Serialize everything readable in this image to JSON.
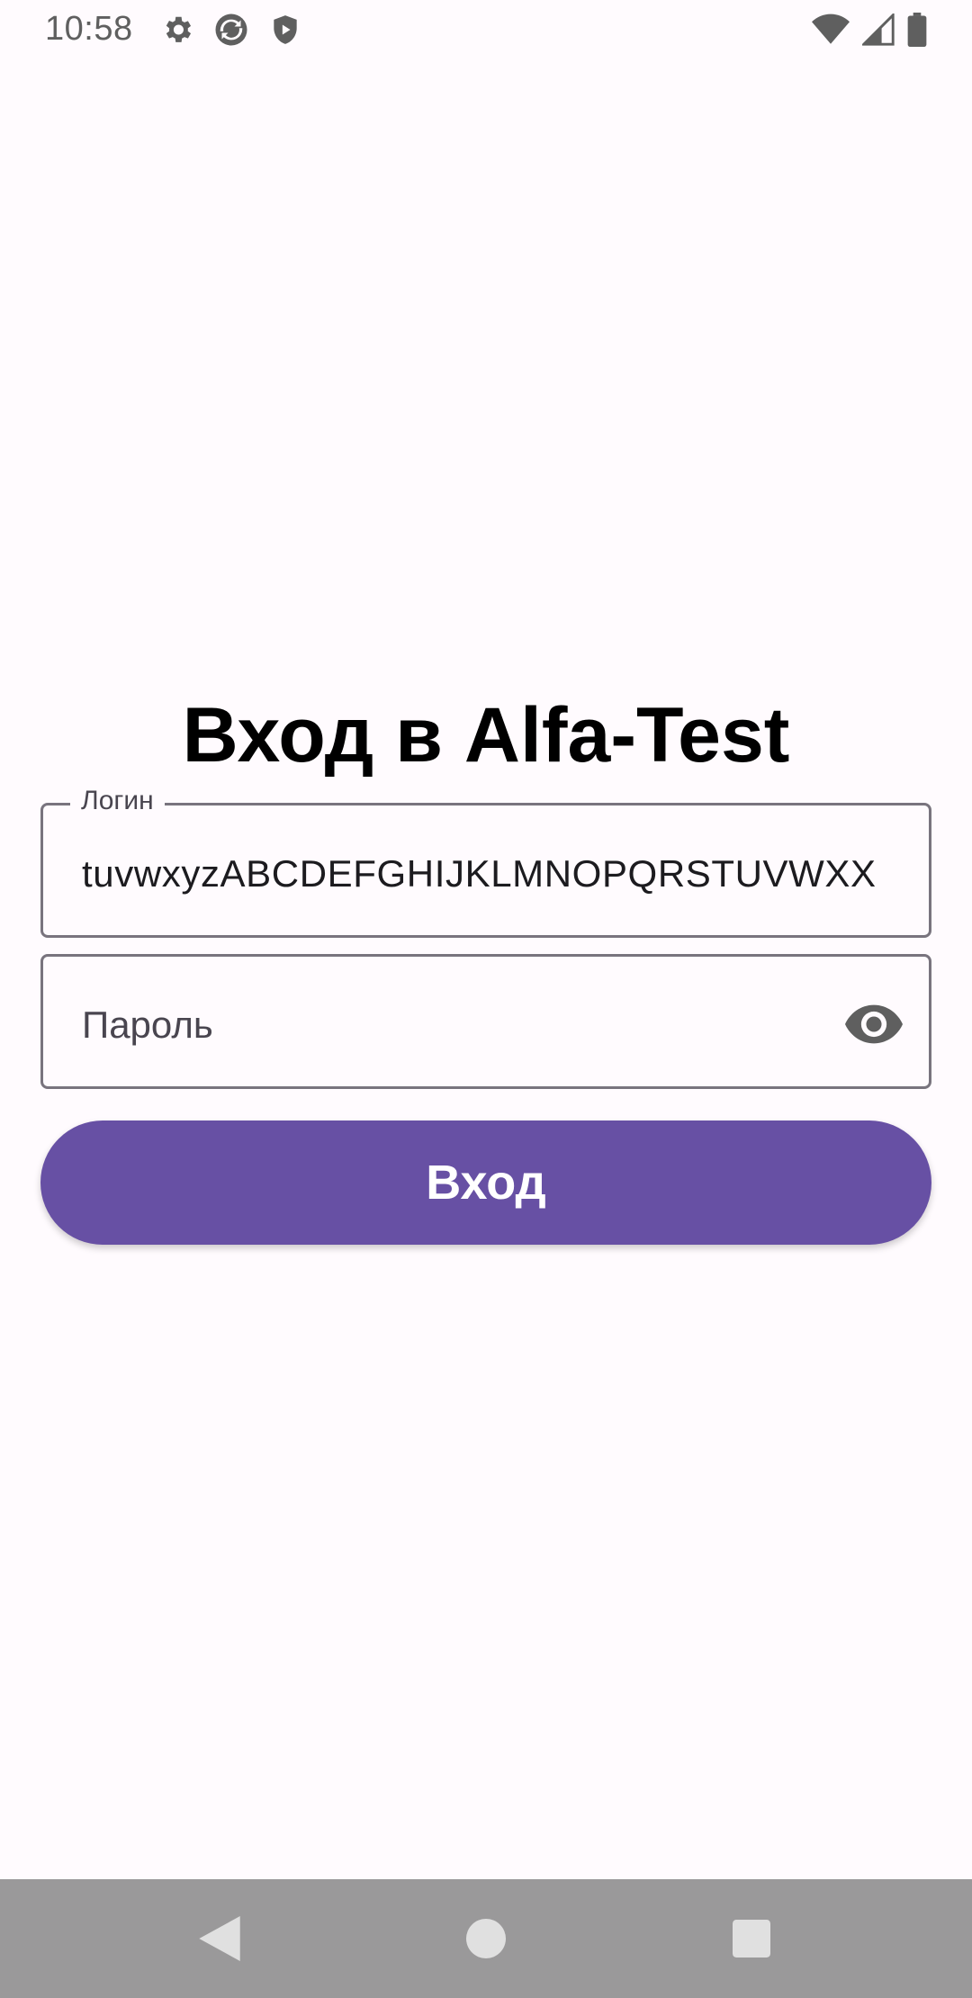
{
  "status_bar": {
    "time": "10:58",
    "left_icons": [
      "gear-icon",
      "sync-icon",
      "shield-play-icon"
    ],
    "right_icons": [
      "wifi-icon",
      "cell-signal-icon",
      "battery-icon"
    ]
  },
  "screen": {
    "title": "Вход в Alfa-Test"
  },
  "login_field": {
    "label": "Логин",
    "value": "tuvwxyzABCDEFGHIJKLMNOPQRSTUVWXX"
  },
  "password_field": {
    "placeholder": "Пароль",
    "toggle_icon": "eye-icon"
  },
  "login_button": {
    "label": "Вход"
  },
  "nav_bar": {
    "icons": [
      "back-icon",
      "home-icon",
      "recents-icon"
    ]
  },
  "colors": {
    "background": "#fffbfe",
    "primary": "#6750a4",
    "outline": "#79747e",
    "nav_bar": "#9a999a"
  }
}
